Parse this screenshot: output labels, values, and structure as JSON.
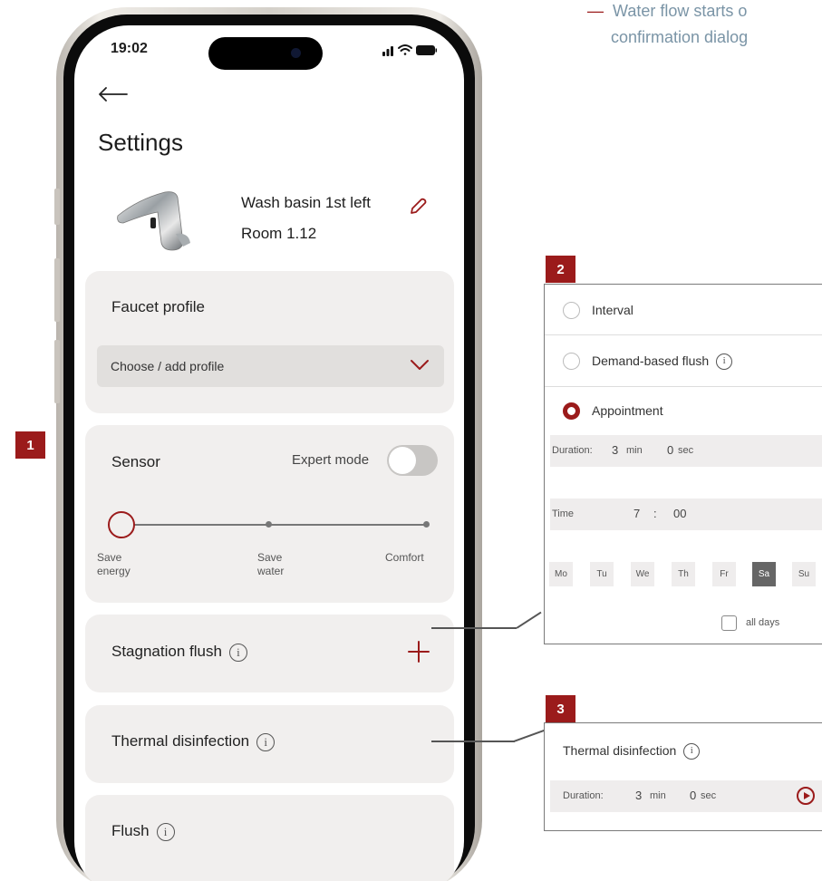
{
  "note": {
    "dash": "—",
    "line1": "Water flow starts o",
    "line2": "confirmation dialog"
  },
  "badges": {
    "b1": "1",
    "b2": "2",
    "b3": "3"
  },
  "status": {
    "time": "19:02"
  },
  "settings": {
    "title": "Settings",
    "device_name": "Wash basin 1st left",
    "room": "Room 1.12"
  },
  "faucet_profile": {
    "title": "Faucet profile",
    "select_value": "Choose / add profile"
  },
  "sensor": {
    "title": "Sensor",
    "expert_mode_label": "Expert mode",
    "expert_mode_on": false,
    "slider_labels": [
      {
        "line1": "Save",
        "line2": "energy"
      },
      {
        "line1": "Save",
        "line2": "water"
      },
      {
        "line1": "Comfort",
        "line2": ""
      }
    ],
    "selected_index": 0
  },
  "stagnation_flush": {
    "title": "Stagnation flush",
    "info": "i"
  },
  "thermal_disinfection": {
    "title": "Thermal disinfection",
    "info": "i"
  },
  "flush": {
    "title": "Flush",
    "info": "i"
  },
  "panel2": {
    "options": [
      "Interval",
      "Demand-based flush",
      "Appointment"
    ],
    "selected": "Appointment",
    "info": "i",
    "duration_label": "Duration:",
    "duration_min": "3",
    "min_unit": "min",
    "duration_sec": "0",
    "sec_unit": "sec",
    "time_label": "Time",
    "hour": "7",
    "colon": ":",
    "minute": "00",
    "days": [
      "Mo",
      "Tu",
      "We",
      "Th",
      "Fr",
      "Sa",
      "Su"
    ],
    "selected_day": "Sa",
    "all_days_label": "all days"
  },
  "panel3": {
    "title": "Thermal disinfection",
    "info": "i",
    "duration_label": "Duration:",
    "duration_min": "3",
    "min_unit": "min",
    "duration_sec": "0",
    "sec_unit": "sec"
  },
  "colors": {
    "accent": "#9b1b1b",
    "card": "#f1efee",
    "note": "#7a94a6"
  }
}
